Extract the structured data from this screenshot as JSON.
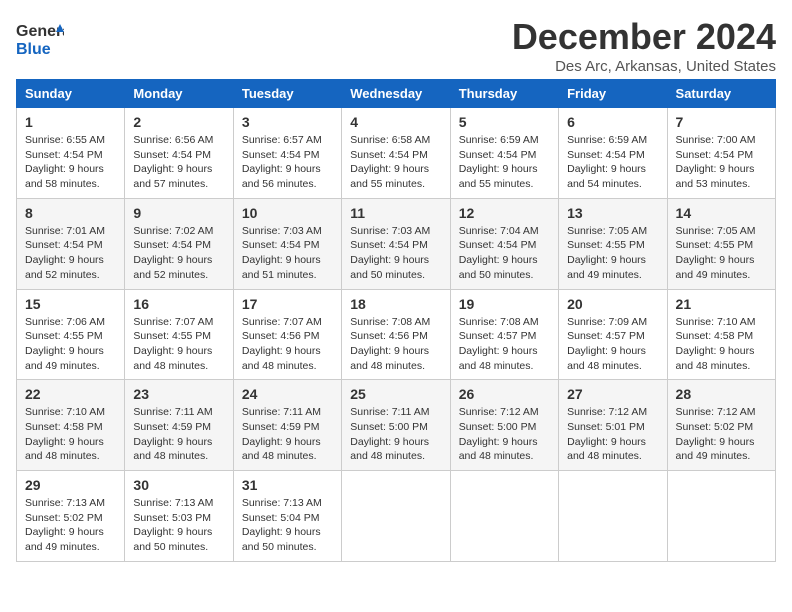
{
  "header": {
    "logo_line1": "General",
    "logo_line2": "Blue",
    "month_title": "December 2024",
    "location": "Des Arc, Arkansas, United States"
  },
  "weekdays": [
    "Sunday",
    "Monday",
    "Tuesday",
    "Wednesday",
    "Thursday",
    "Friday",
    "Saturday"
  ],
  "weeks": [
    [
      {
        "day": "1",
        "sunrise": "6:55 AM",
        "sunset": "4:54 PM",
        "daylight": "9 hours and 58 minutes."
      },
      {
        "day": "2",
        "sunrise": "6:56 AM",
        "sunset": "4:54 PM",
        "daylight": "9 hours and 57 minutes."
      },
      {
        "day": "3",
        "sunrise": "6:57 AM",
        "sunset": "4:54 PM",
        "daylight": "9 hours and 56 minutes."
      },
      {
        "day": "4",
        "sunrise": "6:58 AM",
        "sunset": "4:54 PM",
        "daylight": "9 hours and 55 minutes."
      },
      {
        "day": "5",
        "sunrise": "6:59 AM",
        "sunset": "4:54 PM",
        "daylight": "9 hours and 55 minutes."
      },
      {
        "day": "6",
        "sunrise": "6:59 AM",
        "sunset": "4:54 PM",
        "daylight": "9 hours and 54 minutes."
      },
      {
        "day": "7",
        "sunrise": "7:00 AM",
        "sunset": "4:54 PM",
        "daylight": "9 hours and 53 minutes."
      }
    ],
    [
      {
        "day": "8",
        "sunrise": "7:01 AM",
        "sunset": "4:54 PM",
        "daylight": "9 hours and 52 minutes."
      },
      {
        "day": "9",
        "sunrise": "7:02 AM",
        "sunset": "4:54 PM",
        "daylight": "9 hours and 52 minutes."
      },
      {
        "day": "10",
        "sunrise": "7:03 AM",
        "sunset": "4:54 PM",
        "daylight": "9 hours and 51 minutes."
      },
      {
        "day": "11",
        "sunrise": "7:03 AM",
        "sunset": "4:54 PM",
        "daylight": "9 hours and 50 minutes."
      },
      {
        "day": "12",
        "sunrise": "7:04 AM",
        "sunset": "4:54 PM",
        "daylight": "9 hours and 50 minutes."
      },
      {
        "day": "13",
        "sunrise": "7:05 AM",
        "sunset": "4:55 PM",
        "daylight": "9 hours and 49 minutes."
      },
      {
        "day": "14",
        "sunrise": "7:05 AM",
        "sunset": "4:55 PM",
        "daylight": "9 hours and 49 minutes."
      }
    ],
    [
      {
        "day": "15",
        "sunrise": "7:06 AM",
        "sunset": "4:55 PM",
        "daylight": "9 hours and 49 minutes."
      },
      {
        "day": "16",
        "sunrise": "7:07 AM",
        "sunset": "4:55 PM",
        "daylight": "9 hours and 48 minutes."
      },
      {
        "day": "17",
        "sunrise": "7:07 AM",
        "sunset": "4:56 PM",
        "daylight": "9 hours and 48 minutes."
      },
      {
        "day": "18",
        "sunrise": "7:08 AM",
        "sunset": "4:56 PM",
        "daylight": "9 hours and 48 minutes."
      },
      {
        "day": "19",
        "sunrise": "7:08 AM",
        "sunset": "4:57 PM",
        "daylight": "9 hours and 48 minutes."
      },
      {
        "day": "20",
        "sunrise": "7:09 AM",
        "sunset": "4:57 PM",
        "daylight": "9 hours and 48 minutes."
      },
      {
        "day": "21",
        "sunrise": "7:10 AM",
        "sunset": "4:58 PM",
        "daylight": "9 hours and 48 minutes."
      }
    ],
    [
      {
        "day": "22",
        "sunrise": "7:10 AM",
        "sunset": "4:58 PM",
        "daylight": "9 hours and 48 minutes."
      },
      {
        "day": "23",
        "sunrise": "7:11 AM",
        "sunset": "4:59 PM",
        "daylight": "9 hours and 48 minutes."
      },
      {
        "day": "24",
        "sunrise": "7:11 AM",
        "sunset": "4:59 PM",
        "daylight": "9 hours and 48 minutes."
      },
      {
        "day": "25",
        "sunrise": "7:11 AM",
        "sunset": "5:00 PM",
        "daylight": "9 hours and 48 minutes."
      },
      {
        "day": "26",
        "sunrise": "7:12 AM",
        "sunset": "5:00 PM",
        "daylight": "9 hours and 48 minutes."
      },
      {
        "day": "27",
        "sunrise": "7:12 AM",
        "sunset": "5:01 PM",
        "daylight": "9 hours and 48 minutes."
      },
      {
        "day": "28",
        "sunrise": "7:12 AM",
        "sunset": "5:02 PM",
        "daylight": "9 hours and 49 minutes."
      }
    ],
    [
      {
        "day": "29",
        "sunrise": "7:13 AM",
        "sunset": "5:02 PM",
        "daylight": "9 hours and 49 minutes."
      },
      {
        "day": "30",
        "sunrise": "7:13 AM",
        "sunset": "5:03 PM",
        "daylight": "9 hours and 50 minutes."
      },
      {
        "day": "31",
        "sunrise": "7:13 AM",
        "sunset": "5:04 PM",
        "daylight": "9 hours and 50 minutes."
      },
      null,
      null,
      null,
      null
    ]
  ],
  "labels": {
    "sunrise": "Sunrise: ",
    "sunset": "Sunset: ",
    "daylight": "Daylight: "
  }
}
